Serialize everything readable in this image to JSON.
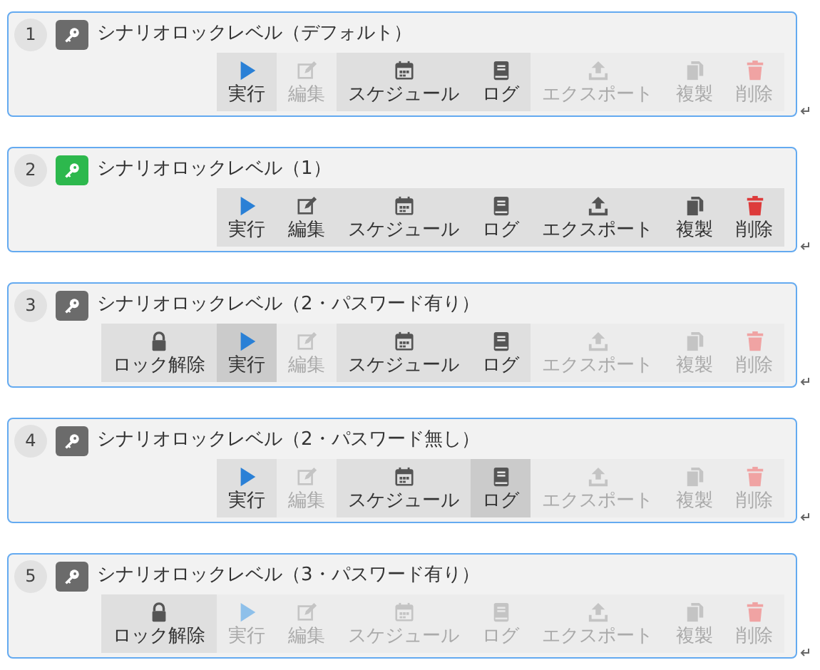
{
  "levels": [
    {
      "number": "1",
      "color": "#6b6b6b",
      "title": "シナリオロックレベル（デフォルト）",
      "buttons": [
        {
          "kind": "run",
          "label": "実行",
          "disabled": false,
          "selected": false
        },
        {
          "kind": "edit",
          "label": "編集",
          "disabled": true,
          "selected": false
        },
        {
          "kind": "schedule",
          "label": "スケジュール",
          "disabled": false,
          "selected": false
        },
        {
          "kind": "log",
          "label": "ログ",
          "disabled": false,
          "selected": false
        },
        {
          "kind": "export",
          "label": "エクスポート",
          "disabled": true,
          "selected": false
        },
        {
          "kind": "copy",
          "label": "複製",
          "disabled": true,
          "selected": false
        },
        {
          "kind": "delete",
          "label": "削除",
          "disabled": true,
          "selected": false
        }
      ]
    },
    {
      "number": "2",
      "color": "#2db84d",
      "title": "シナリオロックレベル（1）",
      "buttons": [
        {
          "kind": "run",
          "label": "実行",
          "disabled": false,
          "selected": false
        },
        {
          "kind": "edit",
          "label": "編集",
          "disabled": false,
          "selected": false
        },
        {
          "kind": "schedule",
          "label": "スケジュール",
          "disabled": false,
          "selected": false
        },
        {
          "kind": "log",
          "label": "ログ",
          "disabled": false,
          "selected": false
        },
        {
          "kind": "export",
          "label": "エクスポート",
          "disabled": false,
          "selected": false
        },
        {
          "kind": "copy",
          "label": "複製",
          "disabled": false,
          "selected": false
        },
        {
          "kind": "delete",
          "label": "削除",
          "disabled": false,
          "selected": false
        }
      ]
    },
    {
      "number": "3",
      "color": "#6b6b6b",
      "title": "シナリオロックレベル（2・パスワード有り）",
      "buttons": [
        {
          "kind": "unlock",
          "label": "ロック解除",
          "disabled": false,
          "selected": false
        },
        {
          "kind": "run",
          "label": "実行",
          "disabled": false,
          "selected": true
        },
        {
          "kind": "edit",
          "label": "編集",
          "disabled": true,
          "selected": false
        },
        {
          "kind": "schedule",
          "label": "スケジュール",
          "disabled": false,
          "selected": false
        },
        {
          "kind": "log",
          "label": "ログ",
          "disabled": false,
          "selected": false
        },
        {
          "kind": "export",
          "label": "エクスポート",
          "disabled": true,
          "selected": false
        },
        {
          "kind": "copy",
          "label": "複製",
          "disabled": true,
          "selected": false
        },
        {
          "kind": "delete",
          "label": "削除",
          "disabled": true,
          "selected": false
        }
      ]
    },
    {
      "number": "4",
      "color": "#6b6b6b",
      "title": "シナリオロックレベル（2・パスワード無し）",
      "buttons": [
        {
          "kind": "run",
          "label": "実行",
          "disabled": false,
          "selected": false
        },
        {
          "kind": "edit",
          "label": "編集",
          "disabled": true,
          "selected": false
        },
        {
          "kind": "schedule",
          "label": "スケジュール",
          "disabled": false,
          "selected": false
        },
        {
          "kind": "log",
          "label": "ログ",
          "disabled": false,
          "selected": true
        },
        {
          "kind": "export",
          "label": "エクスポート",
          "disabled": true,
          "selected": false
        },
        {
          "kind": "copy",
          "label": "複製",
          "disabled": true,
          "selected": false
        },
        {
          "kind": "delete",
          "label": "削除",
          "disabled": true,
          "selected": false
        }
      ]
    },
    {
      "number": "5",
      "color": "#6b6b6b",
      "title": "シナリオロックレベル（3・パスワード有り）",
      "buttons": [
        {
          "kind": "unlock",
          "label": "ロック解除",
          "disabled": false,
          "selected": false
        },
        {
          "kind": "run",
          "label": "実行",
          "disabled": true,
          "selected": false
        },
        {
          "kind": "edit",
          "label": "編集",
          "disabled": true,
          "selected": false
        },
        {
          "kind": "schedule",
          "label": "スケジュール",
          "disabled": true,
          "selected": false
        },
        {
          "kind": "log",
          "label": "ログ",
          "disabled": true,
          "selected": false
        },
        {
          "kind": "export",
          "label": "エクスポート",
          "disabled": true,
          "selected": false
        },
        {
          "kind": "copy",
          "label": "複製",
          "disabled": true,
          "selected": false
        },
        {
          "kind": "delete",
          "label": "削除",
          "disabled": true,
          "selected": false
        }
      ]
    }
  ]
}
